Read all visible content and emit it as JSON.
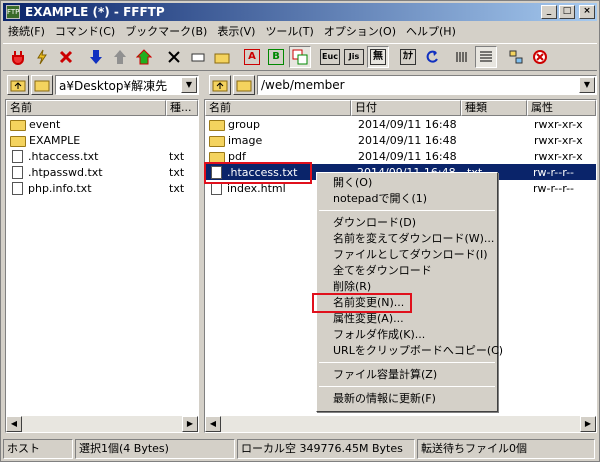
{
  "window": {
    "title": "EXAMPLE (*) - FFFTP",
    "app_icon_label": "FTP"
  },
  "title_buttons": [
    "_",
    "□",
    "×"
  ],
  "menu": [
    "接続(F)",
    "コマンド(C)",
    "ブックマーク(B)",
    "表示(V)",
    "ツール(T)",
    "オプション(O)",
    "ヘルプ(H)"
  ],
  "toolbar": {
    "box_a": "A",
    "box_b": "B",
    "box_euc": "Euc",
    "box_jis": "Jis",
    "box_none": "無",
    "box_kana": "ｶﾅ"
  },
  "local": {
    "path": "a¥Desktop¥解凍先",
    "columns": [
      "名前",
      "種..."
    ],
    "files": [
      {
        "name": "event",
        "type": "",
        "kind": "folder"
      },
      {
        "name": "EXAMPLE",
        "type": "",
        "kind": "folder"
      },
      {
        "name": ".htaccess.txt",
        "type": "txt",
        "kind": "file"
      },
      {
        "name": ".htpasswd.txt",
        "type": "txt",
        "kind": "file"
      },
      {
        "name": "php.info.txt",
        "type": "txt",
        "kind": "file"
      }
    ]
  },
  "remote": {
    "path": "/web/member",
    "columns": [
      "名前",
      "日付",
      "種類",
      "属性"
    ],
    "files": [
      {
        "name": "group",
        "date": "2014/09/11 16:48",
        "type": "",
        "attr": "rwxr-xr-x",
        "kind": "folder"
      },
      {
        "name": "image",
        "date": "2014/09/11 16:48",
        "type": "",
        "attr": "rwxr-xr-x",
        "kind": "folder"
      },
      {
        "name": "pdf",
        "date": "2014/09/11 16:48",
        "type": "",
        "attr": "rwxr-xr-x",
        "kind": "folder"
      },
      {
        "name": ".htaccess.txt",
        "date": "2014/09/11 16:48",
        "type": "txt",
        "attr": "rw-r--r--",
        "kind": "file"
      },
      {
        "name": "index.html",
        "date": "",
        "type": "",
        "attr": "rw-r--r--",
        "kind": "file"
      }
    ]
  },
  "context_menu": {
    "open": "開く(O)",
    "open_notepad": "notepadで開く(1)",
    "download": "ダウンロード(D)",
    "download_rename": "名前を変えてダウンロード(W)...",
    "download_as_file": "ファイルとしてダウンロード(I)",
    "download_all": "全てをダウンロード",
    "delete": "削除(R)",
    "rename": "名前変更(N)...",
    "change_attr": "属性変更(A)...",
    "make_folder": "フォルダ作成(K)...",
    "copy_url": "URLをクリップボードへコピー(C)",
    "calc_size": "ファイル容量計算(Z)",
    "refresh": "最新の情報に更新(F)"
  },
  "status": {
    "host": "ホスト",
    "selection": "選択1個(4 Bytes)",
    "local_free": "ローカル空 349776.45M Bytes",
    "queue": "転送待ちファイル0個"
  },
  "colors": {
    "title_gradient_start": "#0a246a",
    "highlight": "#e0101c",
    "selection": "#0a246a"
  }
}
